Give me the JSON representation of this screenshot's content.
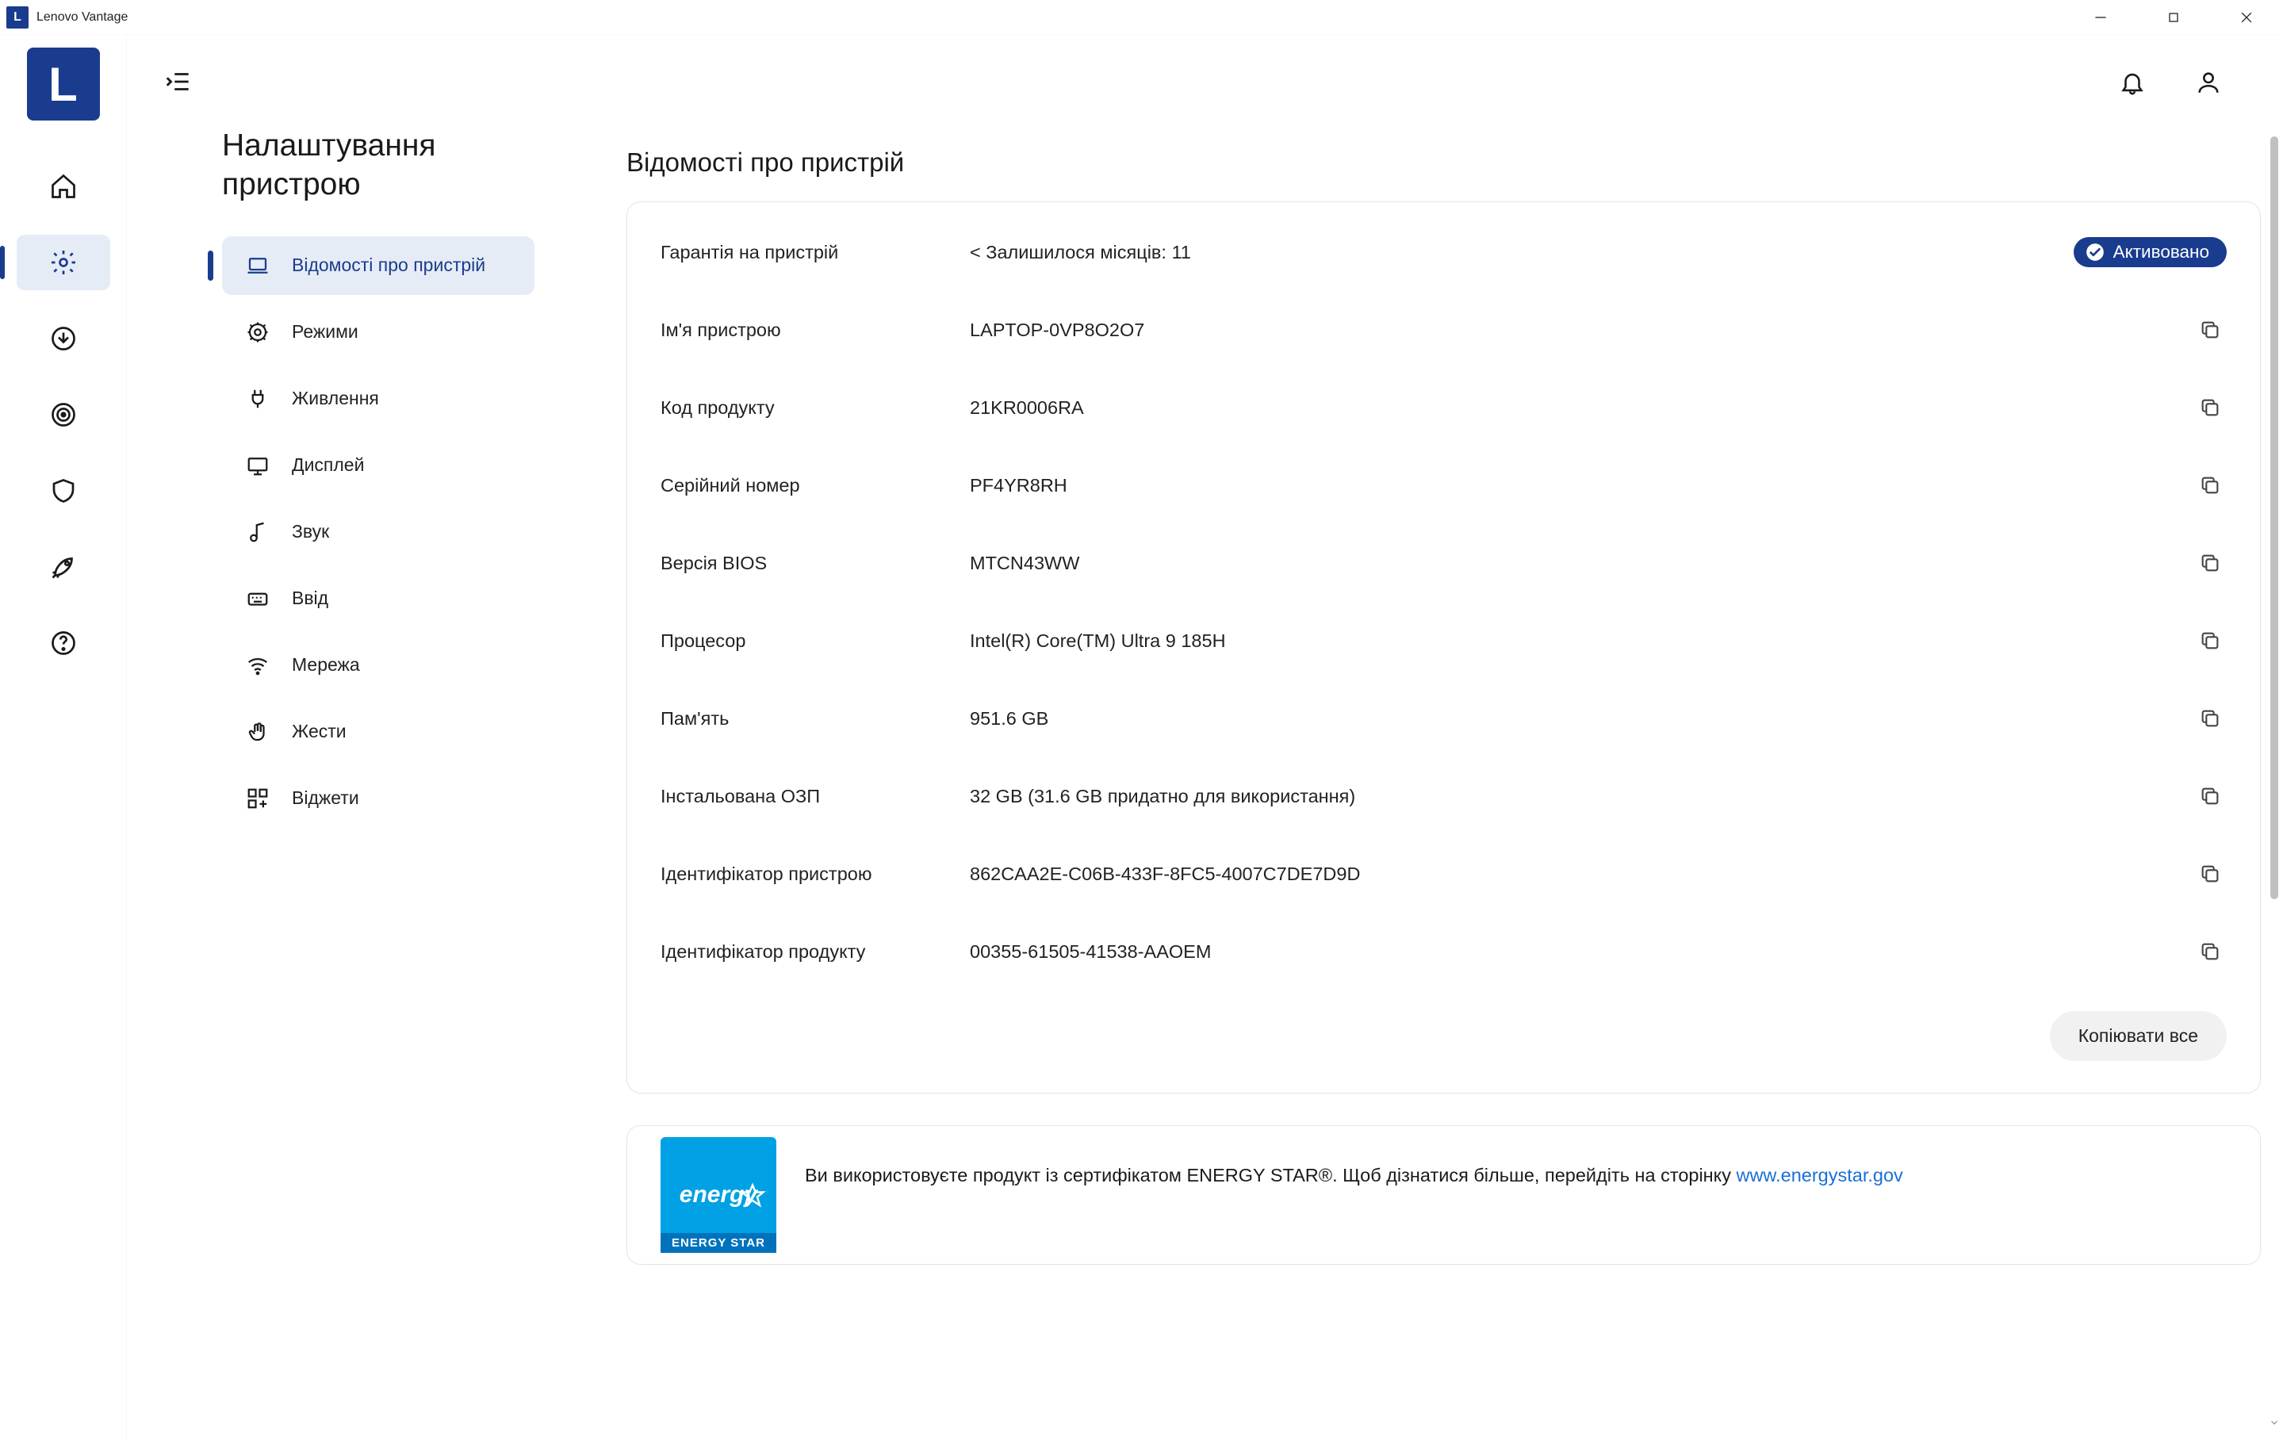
{
  "window": {
    "title": "Lenovo Vantage"
  },
  "page_title_line1": "Налаштування",
  "page_title_line2": "пристрою",
  "subnav": [
    {
      "key": "device-info",
      "label": "Відомості про пристрій",
      "icon": "laptop",
      "active": true
    },
    {
      "key": "modes",
      "label": "Режими",
      "icon": "gear-ring"
    },
    {
      "key": "power",
      "label": "Живлення",
      "icon": "plug"
    },
    {
      "key": "display",
      "label": "Дисплей",
      "icon": "display"
    },
    {
      "key": "sound",
      "label": "Звук",
      "icon": "music-note"
    },
    {
      "key": "input",
      "label": "Ввід",
      "icon": "keyboard"
    },
    {
      "key": "network",
      "label": "Мережа",
      "icon": "wifi"
    },
    {
      "key": "gestures",
      "label": "Жести",
      "icon": "hand"
    },
    {
      "key": "widgets",
      "label": "Віджети",
      "icon": "widgets"
    }
  ],
  "section_title": "Відомості про пристрій",
  "info_card": {
    "warranty": {
      "label": "Гарантія на пристрій",
      "value": "< Залишилося місяців: 11",
      "badge": "Активовано"
    },
    "rows": [
      {
        "key": "device-name",
        "label": "Ім'я пристрою",
        "value": "LAPTOP-0VP8O2O7"
      },
      {
        "key": "product-code",
        "label": "Код продукту",
        "value": "21KR0006RA"
      },
      {
        "key": "serial",
        "label": "Серійний номер",
        "value": "PF4YR8RH"
      },
      {
        "key": "bios",
        "label": "Версія BIOS",
        "value": "MTCN43WW"
      },
      {
        "key": "cpu",
        "label": "Процесор",
        "value": "Intel(R) Core(TM) Ultra 9 185H"
      },
      {
        "key": "storage",
        "label": "Пам'ять",
        "value": "951.6 GB"
      },
      {
        "key": "ram",
        "label": "Інстальована ОЗП",
        "value": "32 GB (31.6 GB придатно для використання)"
      },
      {
        "key": "device-id",
        "label": "Ідентифікатор пристрою",
        "value": "862CAA2E-C06B-433F-8FC5-4007C7DE7D9D"
      },
      {
        "key": "product-id",
        "label": "Ідентифікатор продукту",
        "value": "00355-61505-41538-AAOEM"
      }
    ],
    "copy_all": "Копіювати все"
  },
  "energy": {
    "logo_top": "energy",
    "logo_band": "ENERGY STAR",
    "text_before": "Ви використовуєте продукт із сертифікатом ENERGY STAR®. Щоб дізнатися більше, перейдіть на сторінку ",
    "link_text": "www.energystar.gov"
  }
}
